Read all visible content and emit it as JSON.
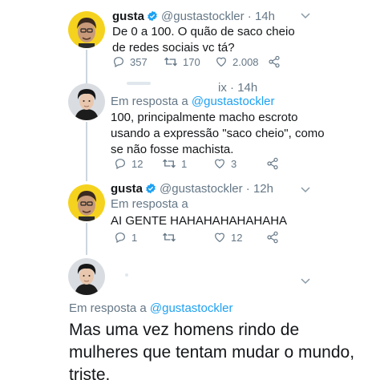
{
  "tweets": [
    {
      "name": "gusta",
      "handle": "@gustastockler",
      "time": "14h",
      "text": "De 0 a 100. O quão de saco cheio de redes sociais vc tá?",
      "replies": "357",
      "retweets": "170",
      "likes": "2.008"
    },
    {
      "name": "",
      "handle": "ix",
      "time": "14h",
      "reply_label": "Em resposta a",
      "reply_to": "@gustastockler",
      "text": "100, principalmente macho escroto usando a expressão \"saco cheio\", como se não fosse machista.",
      "replies": "12",
      "retweets": "1",
      "likes": "3"
    },
    {
      "name": "gusta",
      "handle": "@gustastockler",
      "time": "12h",
      "reply_label": "Em resposta a",
      "reply_to": "",
      "text": "AI GENTE HAHAHAHAHAHAHA",
      "replies": "1",
      "retweets": "",
      "likes": "12"
    }
  ],
  "main_tweet": {
    "reply_label": "Em resposta a",
    "reply_to": "@gustastockler",
    "text": "Mas uma vez homens rindo de mulheres que tentam mudar o mundo, triste."
  },
  "colors": {
    "link": "#1da1f2",
    "secondary": "#657786",
    "verified": "#1da1f2",
    "avatar_gusta_bg": "#f5d21e"
  },
  "icons": [
    "verified-badge-icon",
    "chevron-down-icon",
    "reply-icon",
    "retweet-icon",
    "like-icon",
    "share-icon"
  ]
}
